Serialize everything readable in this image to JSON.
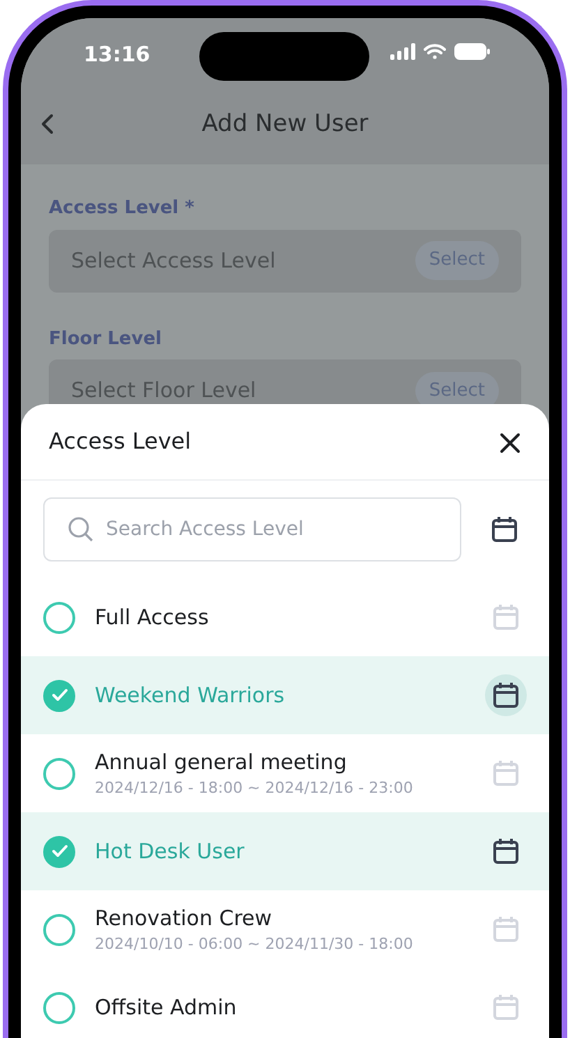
{
  "status_bar": {
    "time": "13:16"
  },
  "header": {
    "title": "Add New User"
  },
  "form": {
    "fields": [
      {
        "label": "Access Level *",
        "placeholder": "Select Access Level",
        "button": "Select"
      },
      {
        "label": "Floor Level",
        "placeholder": "Select Floor Level",
        "button": "Select"
      }
    ]
  },
  "sheet": {
    "title": "Access Level",
    "search": {
      "placeholder": "Search Access Level"
    },
    "items": [
      {
        "name": "Full Access",
        "selected": false,
        "calendar_pressed": false
      },
      {
        "name": "Weekend Warriors",
        "selected": true,
        "calendar_pressed": true
      },
      {
        "name": "Annual general meeting",
        "period": "2024/12/16 - 18:00 ~ 2024/12/16 - 23:00",
        "selected": false,
        "calendar_pressed": false
      },
      {
        "name": "Hot Desk User",
        "selected": true,
        "calendar_pressed": false
      },
      {
        "name": "Renovation Crew",
        "period": "2024/10/10 - 06:00 ~ 2024/11/30 - 18:00",
        "selected": false,
        "calendar_pressed": false
      },
      {
        "name": "Offsite Admin",
        "selected": false,
        "calendar_pressed": false
      }
    ]
  }
}
